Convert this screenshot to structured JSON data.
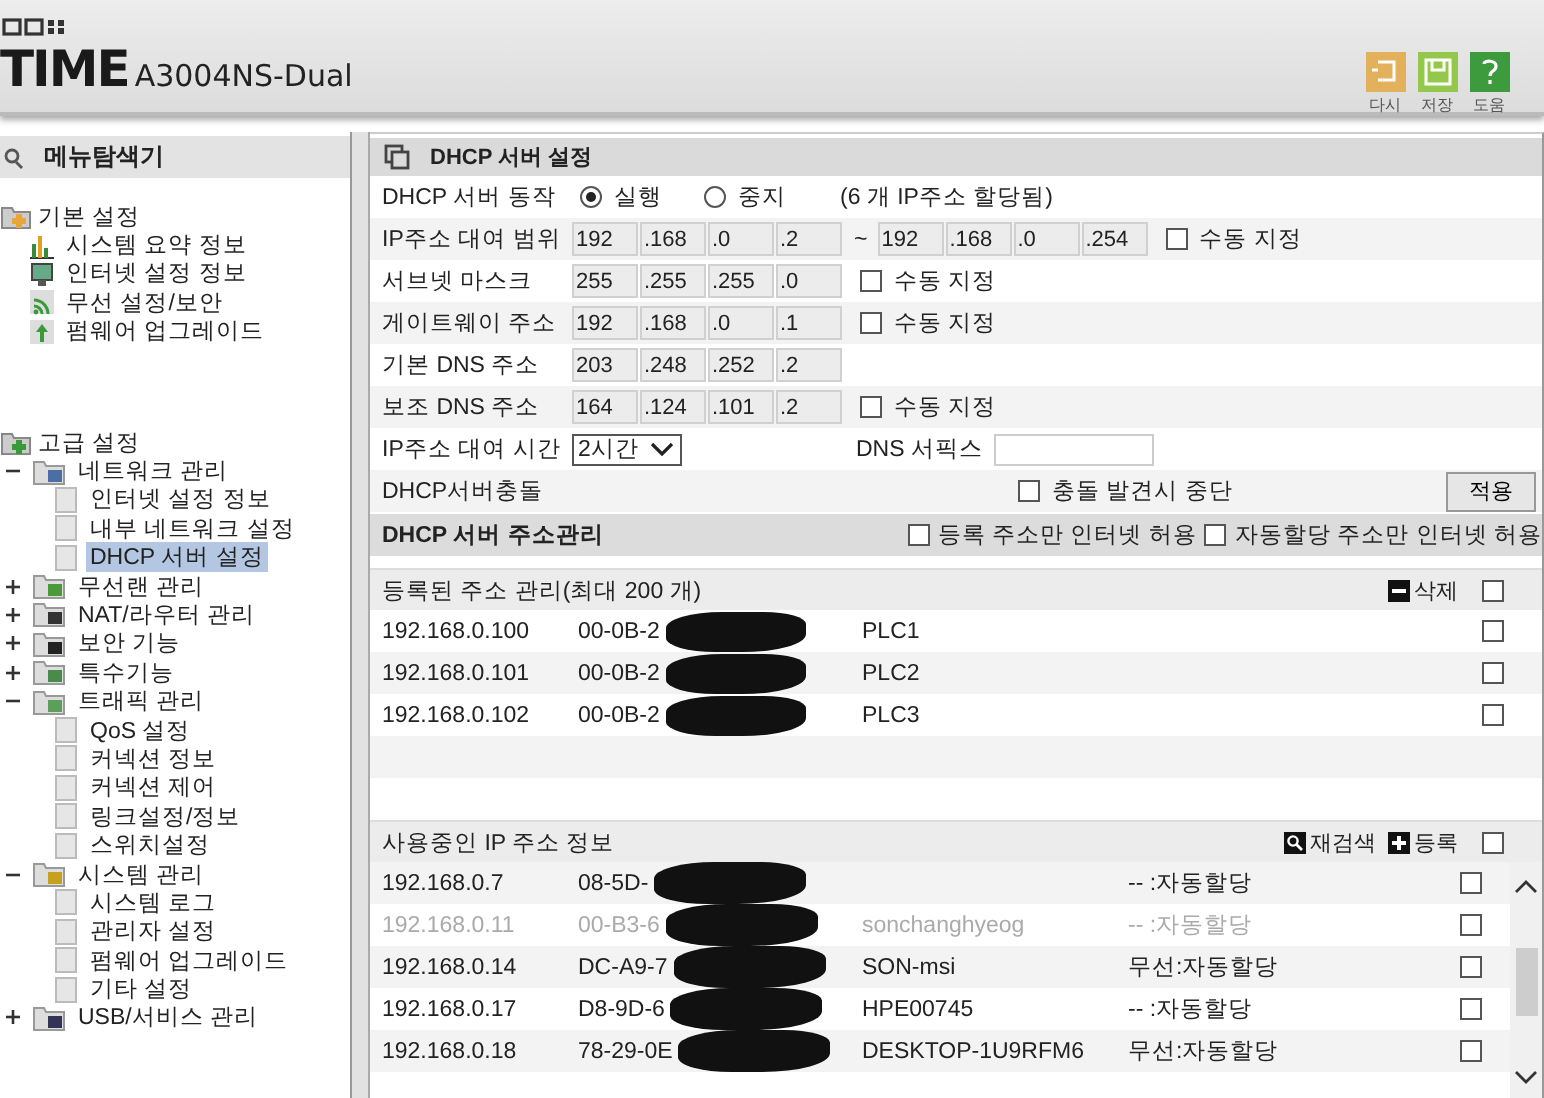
{
  "header": {
    "brand": "TIME",
    "model": "A3004NS-Dual",
    "toolbar": [
      {
        "kind": "undo",
        "label": "다시"
      },
      {
        "kind": "save",
        "label": "저장"
      },
      {
        "kind": "help",
        "label": "도움"
      }
    ]
  },
  "sidebar": {
    "title": "메뉴탐색기",
    "tree": [
      {
        "kind": "group",
        "label": "기본 설정",
        "children": [
          {
            "kind": "leaf",
            "label": "시스템 요약 정보",
            "selected": false
          },
          {
            "kind": "leaf",
            "label": "인터넷 설정 정보",
            "selected": false
          },
          {
            "kind": "leaf",
            "label": "무선 설정/보안",
            "selected": false
          },
          {
            "kind": "leaf",
            "label": "펌웨어 업그레이드",
            "selected": false
          }
        ]
      },
      {
        "kind": "group",
        "label": "고급 설정",
        "children": [
          {
            "kind": "branch",
            "label": "네트워크 관리",
            "expanded": true,
            "selected": false,
            "children": [
              {
                "kind": "leaf",
                "label": "인터넷 설정 정보",
                "selected": false
              },
              {
                "kind": "leaf",
                "label": "내부 네트워크 설정",
                "selected": false
              },
              {
                "kind": "leaf",
                "label": "DHCP 서버 설정",
                "selected": true
              }
            ]
          },
          {
            "kind": "branch",
            "label": "무선랜 관리",
            "expanded": false,
            "selected": false
          },
          {
            "kind": "branch",
            "label": "NAT/라우터 관리",
            "expanded": false,
            "selected": false
          },
          {
            "kind": "branch",
            "label": "보안 기능",
            "expanded": false,
            "selected": false
          },
          {
            "kind": "branch",
            "label": "특수기능",
            "expanded": false,
            "selected": false
          },
          {
            "kind": "branch",
            "label": "트래픽 관리",
            "expanded": true,
            "selected": false,
            "children": [
              {
                "kind": "leaf",
                "label": "QoS 설정",
                "selected": false
              },
              {
                "kind": "leaf",
                "label": "커넥션 정보",
                "selected": false
              },
              {
                "kind": "leaf",
                "label": "커넥션 제어",
                "selected": false
              },
              {
                "kind": "leaf",
                "label": "링크설정/정보",
                "selected": false
              },
              {
                "kind": "leaf",
                "label": "스위치설정",
                "selected": false
              }
            ]
          },
          {
            "kind": "branch",
            "label": "시스템 관리",
            "expanded": true,
            "selected": false,
            "children": [
              {
                "kind": "leaf",
                "label": "시스템 로그",
                "selected": false
              },
              {
                "kind": "leaf",
                "label": "관리자 설정",
                "selected": false
              },
              {
                "kind": "leaf",
                "label": "펌웨어 업그레이드",
                "selected": false
              },
              {
                "kind": "leaf",
                "label": "기타 설정",
                "selected": false
              }
            ]
          },
          {
            "kind": "branch",
            "label": "USB/서비스 관리",
            "expanded": false,
            "selected": false
          }
        ]
      }
    ]
  },
  "panel": {
    "title": "DHCP 서버 설정",
    "rows": [
      {
        "kind": "radio",
        "label": "DHCP 서버 동작",
        "options": [
          {
            "label": "실행",
            "selected": true
          },
          {
            "label": "중지",
            "selected": false
          }
        ],
        "note": "(6 개 IP주소 할당됨)"
      },
      {
        "kind": "range",
        "label": "IP주소 대여 범위",
        "octets": [
          "192",
          ".168",
          ".0",
          ".2"
        ],
        "separator": "~",
        "octets_end": [
          "192",
          ".168",
          ".0",
          ".254"
        ],
        "manual": {
          "label": "수동 지정",
          "checked": false
        }
      },
      {
        "kind": "ip",
        "label": "서브넷 마스크",
        "octets": [
          "255",
          ".255",
          ".255",
          ".0"
        ],
        "manual": {
          "label": "수동 지정",
          "checked": false
        }
      },
      {
        "kind": "ip",
        "label": "게이트웨이 주소",
        "octets": [
          "192",
          ".168",
          ".0",
          ".1"
        ],
        "manual": {
          "label": "수동 지정",
          "checked": false
        }
      },
      {
        "kind": "ip",
        "label": "기본 DNS 주소",
        "octets": [
          "203",
          ".248",
          ".252",
          ".2"
        ]
      },
      {
        "kind": "ip",
        "label": "보조 DNS 주소",
        "octets": [
          "164",
          ".124",
          ".101",
          ".2"
        ],
        "manual": {
          "label": "수동 지정",
          "checked": false
        }
      },
      {
        "kind": "select",
        "label": "IP주소 대여 시간",
        "value": "2시간",
        "field_label": "DNS 서픽스"
      },
      {
        "kind": "conflict",
        "label": "DHCP서버충돌",
        "check": {
          "label": "충돌 발견시 중단",
          "checked": false
        },
        "button": "적용"
      }
    ]
  },
  "address_management": {
    "title": "DHCP 서버 주소관리",
    "checks": [
      {
        "label": "등록 주소만 인터넷 허용",
        "checked": false
      },
      {
        "label": "자동할당 주소만 인터넷 허용",
        "checked": false
      }
    ]
  },
  "registered": {
    "title": "등록된 주소 관리(최대 200 개)",
    "actions": [
      {
        "kind": "minus",
        "label": "삭제"
      }
    ],
    "checked": false,
    "rows": [
      {
        "ip": "192.168.0.100",
        "mac": "00-0B-2",
        "name": "PLC1",
        "checked": false
      },
      {
        "ip": "192.168.0.101",
        "mac": "00-0B-2",
        "name": "PLC2",
        "checked": false
      },
      {
        "ip": "192.168.0.102",
        "mac": "00-0B-2",
        "name": "PLC3",
        "checked": false
      }
    ]
  },
  "in_use": {
    "title": "사용중인 IP 주소 정보",
    "actions": [
      {
        "kind": "search",
        "label": "재검색"
      },
      {
        "kind": "plus",
        "label": "등록"
      }
    ],
    "checked": false,
    "rows": [
      {
        "ip": "192.168.0.7",
        "mac": "08-5D-",
        "type": "-- :자동할당",
        "inactive": false,
        "checked": false
      },
      {
        "ip": "192.168.0.11",
        "mac": "00-B3-6",
        "name": "sonchanghyeog",
        "type": "-- :자동할당",
        "inactive": true,
        "checked": false
      },
      {
        "ip": "192.168.0.14",
        "mac": "DC-A9-7",
        "name": "SON-msi",
        "type": "무선:자동할당",
        "inactive": false,
        "checked": false
      },
      {
        "ip": "192.168.0.17",
        "mac": "D8-9D-6",
        "name": "HPE00745",
        "type": "-- :자동할당",
        "inactive": false,
        "checked": false
      },
      {
        "ip": "192.168.0.18",
        "mac": "78-29-0E",
        "name": "DESKTOP-1U9RFM6",
        "type": "무선:자동할당",
        "inactive": false,
        "checked": false
      }
    ]
  }
}
